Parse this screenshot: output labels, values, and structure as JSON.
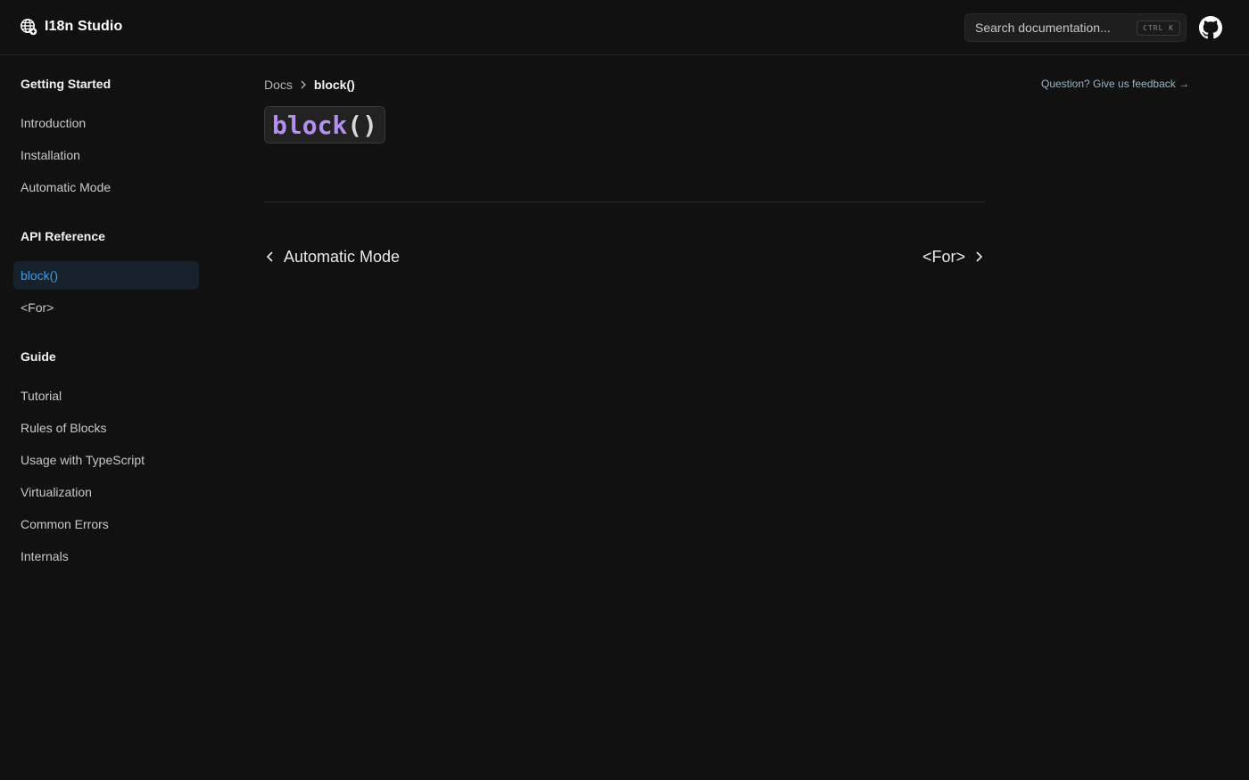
{
  "header": {
    "brand": "I18n Studio",
    "brand_icon": "globe-icon",
    "search": {
      "placeholder": "Search documentation...",
      "shortcut": "CTRL K"
    },
    "github_icon": "github-icon"
  },
  "sidebar": {
    "sections": [
      {
        "title": "Getting Started",
        "items": [
          "Introduction",
          "Installation",
          "Automatic Mode"
        ]
      },
      {
        "title": "API Reference",
        "items": [
          "block()",
          "<For>"
        ],
        "active": "block()"
      },
      {
        "title": "Guide",
        "items": [
          "Tutorial",
          "Rules of Blocks",
          "Usage with TypeScript",
          "Virtualization",
          "Common Errors",
          "Internals"
        ]
      }
    ]
  },
  "breadcrumb": {
    "root": "Docs",
    "current": "block()"
  },
  "page": {
    "title_keyword": "block",
    "title_parens": "()"
  },
  "pager": {
    "prev_label": "Automatic Mode",
    "next_label": "<For>"
  },
  "feedback": {
    "label": "Question? Give us feedback →"
  },
  "colors": {
    "background": "#111111",
    "active_bg": "#16212c",
    "active_text": "#3b9ee9",
    "title_keyword": "#b48ef0"
  }
}
